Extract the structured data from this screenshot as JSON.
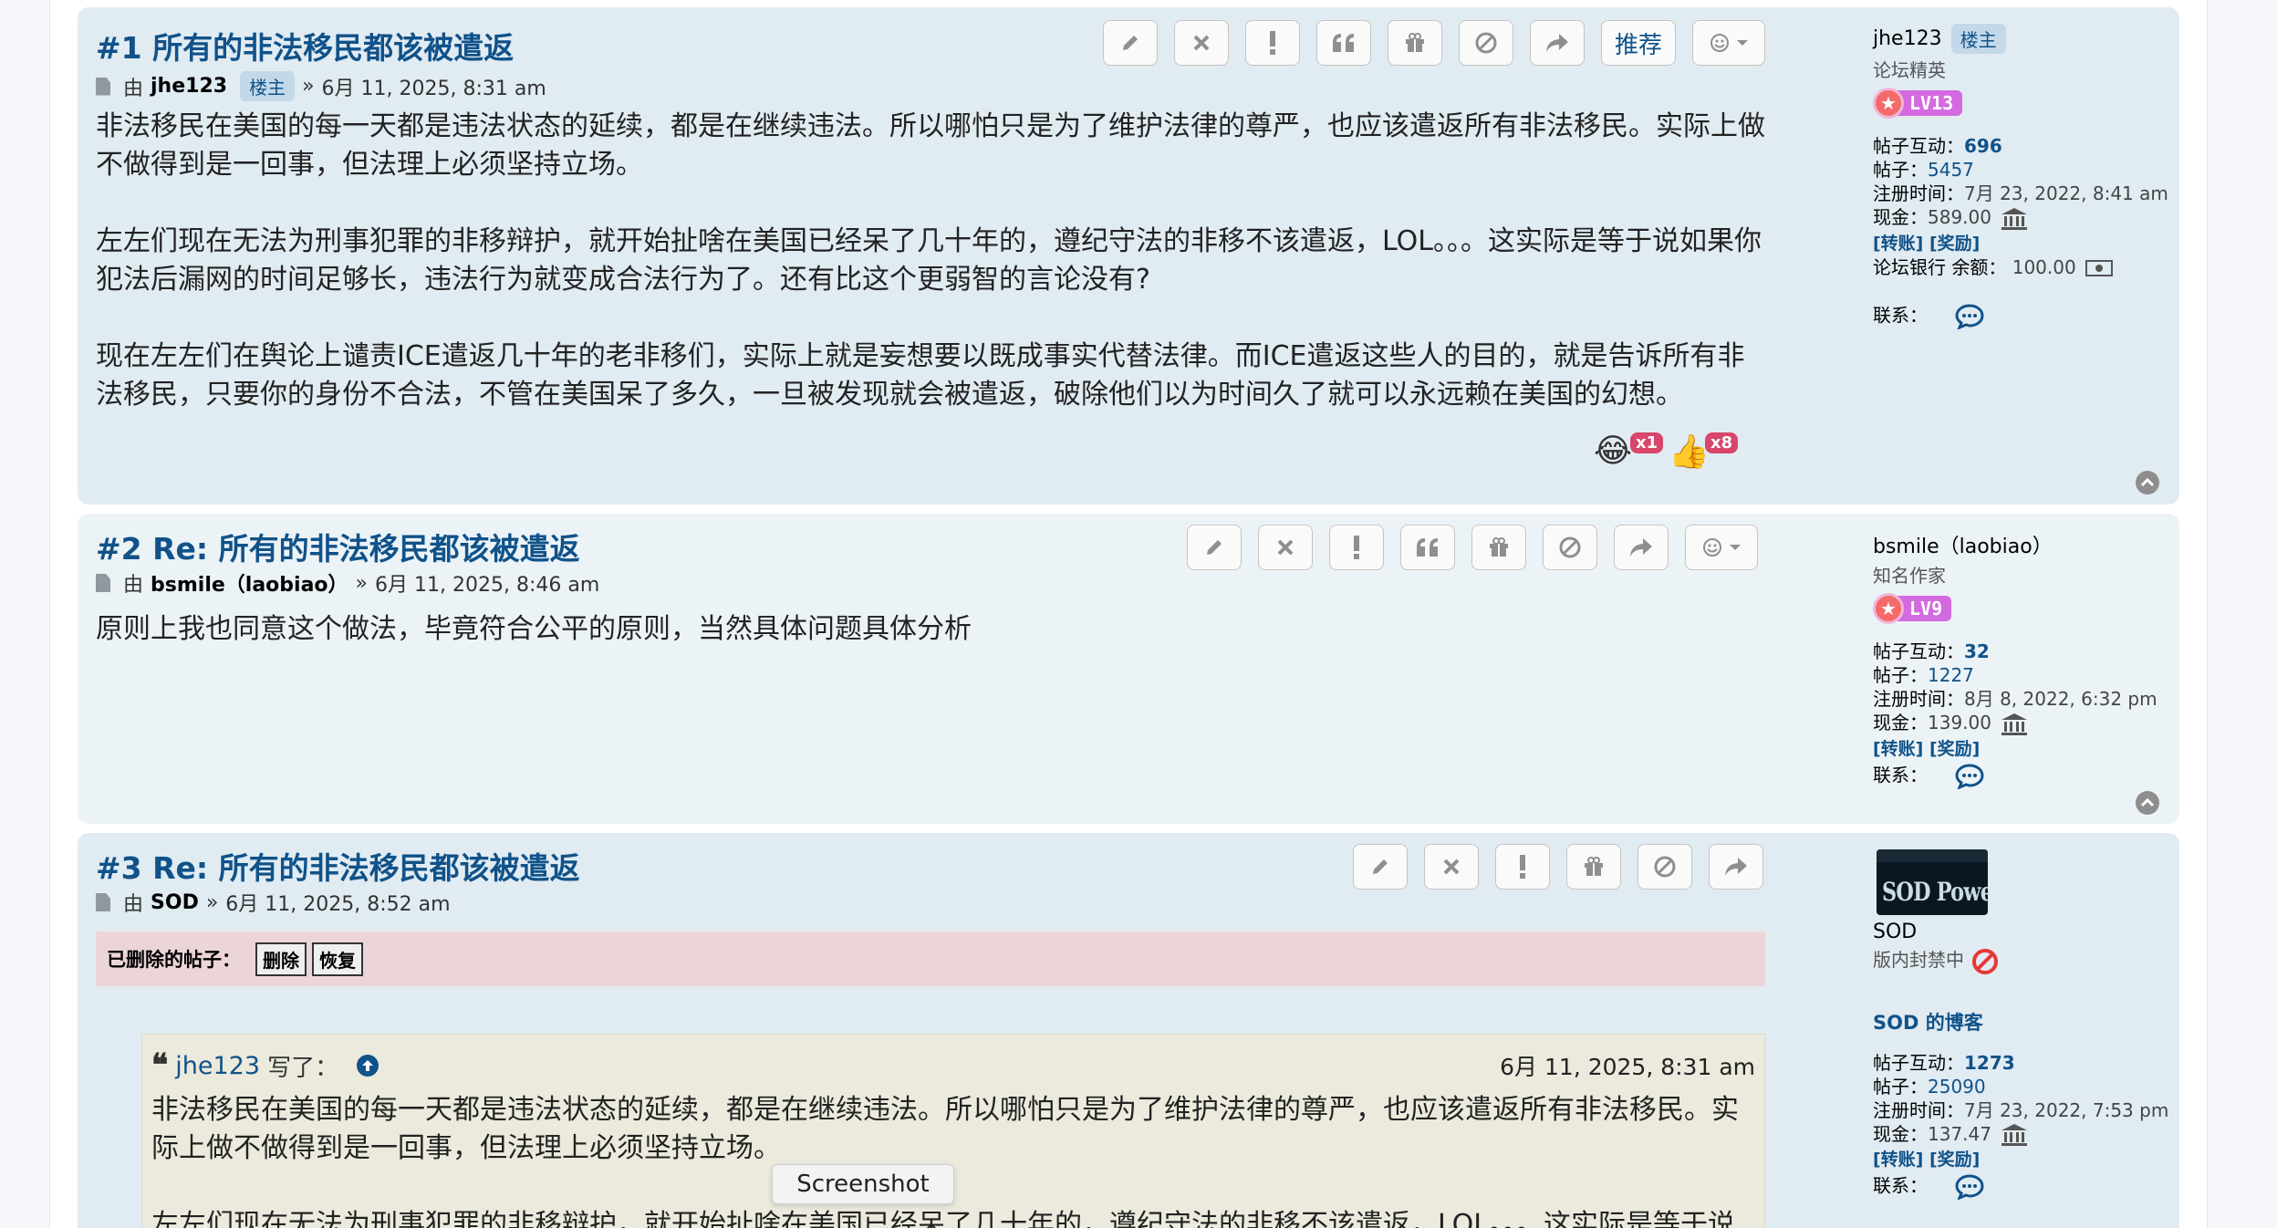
{
  "colors": {
    "link": "#105289",
    "post_bg": "#e1ebf2",
    "post_bg_alt": "#ecf3f7",
    "reaction_badge": "#d9466b"
  },
  "labels": {
    "by": "由",
    "sep": "»",
    "interactions": "帖子互动：",
    "posts": "帖子：",
    "joined": "注册时间：",
    "cash": "现金：",
    "transfer": "[转账]",
    "reward": "[奖励]",
    "bank": "论坛银行 余额：",
    "contact": "联系："
  },
  "posts": [
    {
      "title": "#1 所有的非法移民都该被遣返",
      "author": "jhe123",
      "op_badge": "楼主",
      "date": "6月 11, 2025, 8:31 am",
      "paragraphs": [
        "非法移民在美国的每一天都是违法状态的延续，都是在继续违法。所以哪怕只是为了维护法律的尊严，也应该遣返所有非法移民。实际上做不做得到是一回事，但法理上必须坚持立场。",
        "左左们现在无法为刑事犯罪的非移辩护，就开始扯啥在美国已经呆了几十年的，遵纪守法的非移不该遣返，LOL。。。这实际是等于说如果你犯法后漏网的时间足够长，违法行为就变成合法行为了。还有比这个更弱智的言论没有?",
        "现在左左们在舆论上谴责ICE遣返几十年的老非移们，实际上就是妄想要以既成事实代替法律。而ICE遣返这些人的目的，就是告诉所有非法移民，只要你的身份不合法，不管在美国呆了多久，一旦被发现就会被遣返，破除他们以为时间久了就可以永远赖在美国的幻想。"
      ],
      "recommend_label": "推荐",
      "reactions": [
        {
          "emoji": "😂",
          "count": "x1"
        },
        {
          "emoji": "👍",
          "count": "x8"
        }
      ],
      "profile": {
        "name": "jhe123",
        "badge": "楼主",
        "rank": "论坛精英",
        "level": "LV13",
        "interactions": "696",
        "posts": "5457",
        "joined": "7月 23, 2022, 8:41 am",
        "cash": "589.00",
        "bank_balance": "100.00"
      }
    },
    {
      "title": "#2 Re: 所有的非法移民都该被遣返",
      "author": "bsmile（laobiao）",
      "date": "6月 11, 2025, 8:46 am",
      "paragraphs": [
        "原则上我也同意这个做法，毕竟符合公平的原则，当然具体问题具体分析"
      ],
      "profile": {
        "name": "bsmile（laobiao）",
        "rank": "知名作家",
        "level": "LV9",
        "interactions": "32",
        "posts": "1227",
        "joined": "8月 8, 2022, 6:32 pm",
        "cash": "139.00"
      }
    },
    {
      "title": "#3 Re: 所有的非法移民都该被遣返",
      "author": "SOD",
      "date": "6月 11, 2025, 8:52 am",
      "deleted_label": "已删除的帖子：",
      "delete_btn": "删除",
      "restore_btn": "恢复",
      "quote": {
        "author": "jhe123",
        "wrote": "写了：",
        "date": "6月 11, 2025, 8:31 am",
        "paragraphs": [
          "非法移民在美国的每一天都是违法状态的延续，都是在继续违法。所以哪怕只是为了维护法律的尊严，也应该遣返所有非法移民。实际上做不做得到是一回事，但法理上必须坚持立场。",
          "左左们现在无法为刑事犯罪的非移辩护，就开始扯啥在美国已经呆了几十年的，遵纪守法的非移不该遣返，LOL。。。这实际是等于说如果你"
        ]
      },
      "profile": {
        "name": "SOD",
        "status": "版内封禁中",
        "avatar_text": "SOD Power",
        "blog": "SOD 的博客",
        "interactions": "1273",
        "posts": "25090",
        "joined": "7月 23, 2022, 7:53 pm",
        "cash": "137.47"
      }
    }
  ],
  "tooltip": "Screenshot"
}
